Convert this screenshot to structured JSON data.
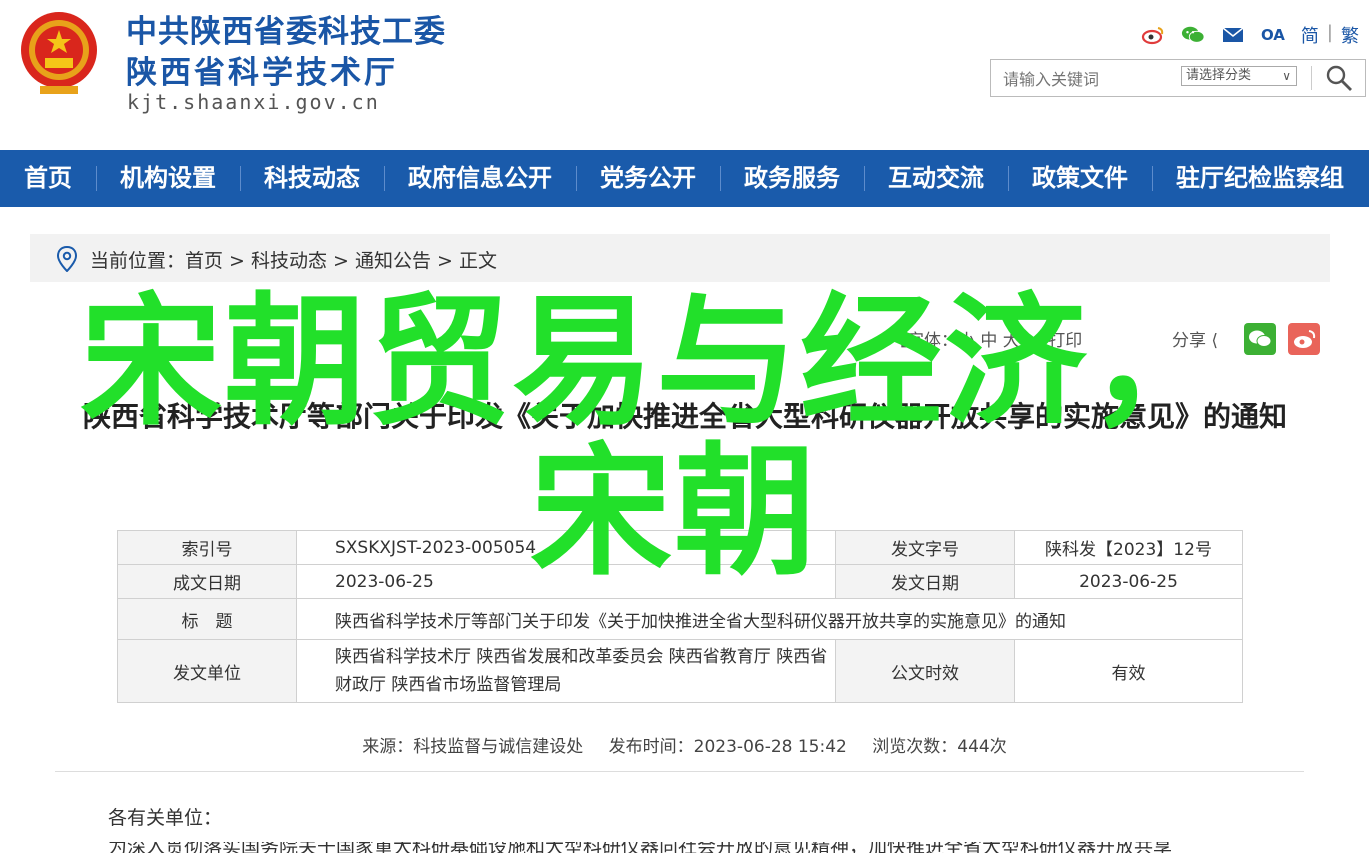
{
  "header": {
    "name_line1": "中共陕西省委科技工委",
    "name_line2": "陕西省科学技术厅",
    "domain": "kjt.shaanxi.gov.cn",
    "icons": [
      "weibo-icon",
      "wechat-icon",
      "mail-icon",
      "oa-icon"
    ],
    "oa_label": "OA",
    "lang_simplified": "简",
    "lang_sep": "|",
    "lang_traditional": "繁",
    "search": {
      "placeholder": "请输入关键词",
      "category": "请选择分类",
      "arrow": "∨"
    }
  },
  "nav": {
    "items": [
      "首页",
      "机构设置",
      "科技动态",
      "政府信息公开",
      "党务公开",
      "政务服务",
      "互动交流",
      "政策文件",
      "驻厅纪检监察组"
    ]
  },
  "breadcrumb": {
    "text": "当前位置：首页 > 科技动态 > 通知公告 > 正文"
  },
  "toolbar": {
    "font_size": "【字体：小 中 大】",
    "print": "打印",
    "share": "分享"
  },
  "article": {
    "title": "陕西省科学技术厅等部门关于印发《关于加快推进全省大型科研仪器开放共享的实施意见》的通知",
    "info": {
      "index_label": "索引号",
      "index_value": "SXSKXJST-2023-005054",
      "doc_no_label": "发文字号",
      "doc_no_value": "陕科发【2023】12号",
      "date_label": "成文日期",
      "date_value": "2023-06-25",
      "issue_date_label": "发文日期",
      "issue_date_value": "2023-06-25",
      "title_label": "标　题",
      "title_value": "陕西省科学技术厅等部门关于印发《关于加快推进全省大型科研仪器开放共享的实施意见》的通知",
      "issuer_label": "发文单位",
      "issuer_value": "陕西省科学技术厅 陕西省发展和改革委员会 陕西省教育厅 陕西省财政厅 陕西省市场监督管理局",
      "validity_label": "公文时效",
      "validity_value": "有效"
    },
    "meta": {
      "source": "来源：科技监督与诚信建设处",
      "published": "发布时间：2023-06-28 15:42",
      "views": "浏览次数：444次"
    },
    "greeting": "各有关单位：",
    "partial_line": "为深入贯彻落实国务院关于国家重大科研基础设施和大型科研仪器向社会开放的意见精神，加快推进全省大型科研仪器开放共享"
  },
  "overlay": {
    "line1": "宋朝贸易与经济，",
    "line2": "宋朝",
    "color": "#22e02a"
  }
}
